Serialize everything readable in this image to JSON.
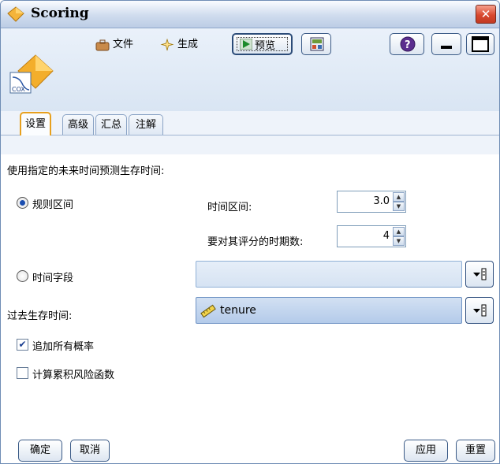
{
  "window": {
    "title": "Scoring",
    "close_symbol": "✕"
  },
  "toolbar": {
    "node_icon": "cox-node-icon",
    "node_label": "COX",
    "menu_file": "文件",
    "menu_generate": "生成",
    "preview_label": "预览"
  },
  "tabs": [
    {
      "label": "设置",
      "active": true
    },
    {
      "label": "高级",
      "active": false
    },
    {
      "label": "汇总",
      "active": false
    },
    {
      "label": "注解",
      "active": false
    }
  ],
  "settings": {
    "heading": "使用指定的未来时间预测生存时间:",
    "regular_intervals_label": "规则区间",
    "regular_intervals_selected": true,
    "time_interval_label": "时间区间:",
    "time_interval_value": "3.0",
    "periods_label": "要对其评分的时期数:",
    "periods_value": "4",
    "time_field_label": "时间字段",
    "time_field_selected": false,
    "time_field_value": "",
    "past_survival_label": "过去生存时间:",
    "past_survival_value": "tenure",
    "append_probabilities_label": "追加所有概率",
    "append_probabilities_checked": true,
    "cumulative_hazard_label": "计算累积风险函数",
    "cumulative_hazard_checked": false
  },
  "buttons": {
    "ok": "确定",
    "cancel": "取消",
    "apply": "应用",
    "reset": "重置"
  },
  "colors": {
    "accent_tab": "#e7a01e",
    "title_bar": "#cfdcee",
    "close": "#d8482e"
  }
}
